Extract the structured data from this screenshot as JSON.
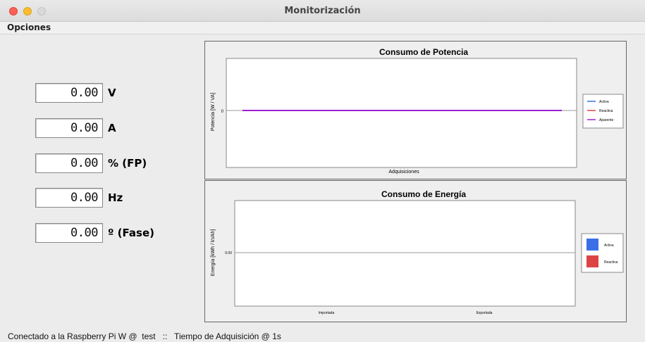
{
  "window": {
    "title": "Monitorización"
  },
  "menu": {
    "options_label": "Opciones"
  },
  "meters": [
    {
      "value": "0.00",
      "unit": "V"
    },
    {
      "value": "0.00",
      "unit": "A"
    },
    {
      "value": "0.00",
      "unit": "% (FP)"
    },
    {
      "value": "0.00",
      "unit": "Hz"
    },
    {
      "value": "0.00",
      "unit": "º (Fase)"
    }
  ],
  "chart_data": [
    {
      "type": "line",
      "title": "Consumo de Potencia",
      "xlabel": "Adquisiciones",
      "ylabel": "Potencia [W / VA]",
      "y_ticks": [
        "0"
      ],
      "legend_position": "right",
      "series": [
        {
          "name": "Activa",
          "color": "#3b6fe8",
          "values": [
            0,
            0
          ]
        },
        {
          "name": "Reactiva",
          "color": "#e04040",
          "values": [
            0,
            0
          ]
        },
        {
          "name": "Aparente",
          "color": "#a020d0",
          "values": [
            0,
            0
          ]
        }
      ]
    },
    {
      "type": "bar",
      "title": "Consumo de Energía",
      "ylabel": "Energía [kWh / kVAh]",
      "y_ticks": [
        "0.00"
      ],
      "categories": [
        "Importada",
        "Exportada"
      ],
      "legend_position": "right",
      "series": [
        {
          "name": "Activa",
          "color": "#3b6fe8",
          "values": [
            0,
            0
          ]
        },
        {
          "name": "Reactiva",
          "color": "#dc4444",
          "values": [
            0,
            0
          ]
        }
      ]
    }
  ],
  "status": {
    "text": "Conectado a la Raspberry Pi W @  test   ::   Tiempo de Adquisición @ 1s"
  }
}
